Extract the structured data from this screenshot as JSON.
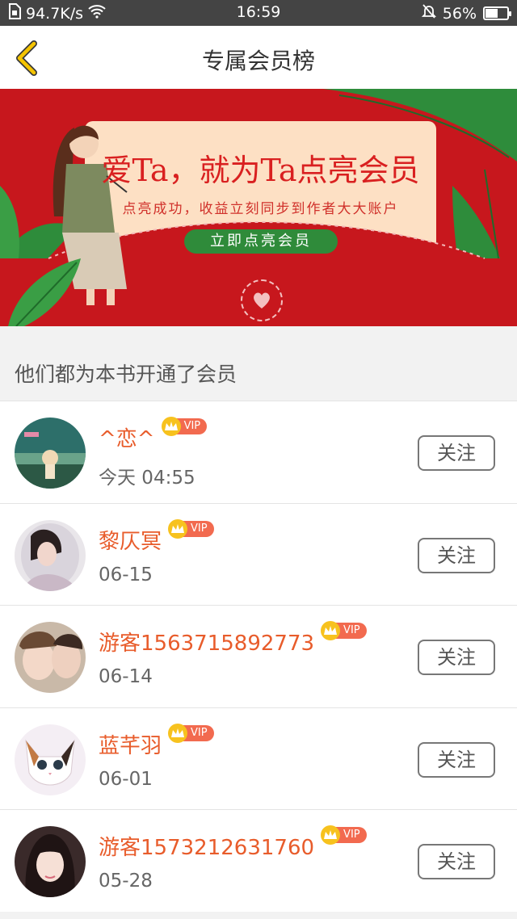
{
  "status_bar": {
    "network_speed": "94.7K/s",
    "time": "16:59",
    "battery": "56%",
    "battery_level": 0.56
  },
  "header": {
    "title": "专属会员榜",
    "back_icon": "chevron-left-icon"
  },
  "banner": {
    "headline": "爱Ta，就为Ta点亮会员",
    "subtitle": "点亮成功，收益立刻同步到作者大大账户",
    "button_label": "立即点亮会员",
    "colors": {
      "background": "#c7171d",
      "envelope": "#fde0c4",
      "button": "#2f8b3a"
    }
  },
  "section": {
    "title": "他们都为本书开通了会员"
  },
  "members": [
    {
      "name": "^恋^",
      "badge": "VIP",
      "time": "今天 04:55",
      "follow_label": "关注"
    },
    {
      "name": "黎仄冥",
      "badge": "VIP",
      "time": "06-15",
      "follow_label": "关注"
    },
    {
      "name": "游客1563715892773",
      "badge": "VIP",
      "time": "06-14",
      "follow_label": "关注"
    },
    {
      "name": "蓝芊羽",
      "badge": "VIP",
      "time": "06-01",
      "follow_label": "关注"
    },
    {
      "name": "游客1573212631760",
      "badge": "VIP",
      "time": "05-28",
      "follow_label": "关注"
    }
  ],
  "colors": {
    "name": "#e85c2b",
    "vip_badge": "#f26a4f",
    "vip_crown": "#f7c21e",
    "back_chevron": "#f5c400"
  }
}
